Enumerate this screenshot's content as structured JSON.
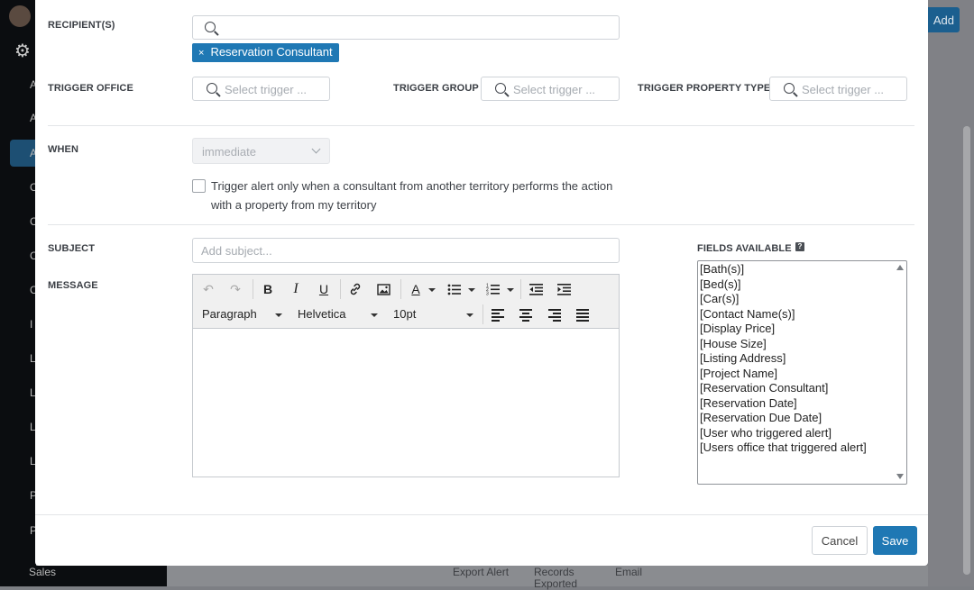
{
  "background": {
    "add_label": "Add",
    "sidebar_letters": [
      "A",
      "A",
      "A",
      "C",
      "C",
      "C",
      "C",
      "I",
      "L",
      "L",
      "L",
      "L",
      "P",
      "P"
    ],
    "sidebar_bottom_label": "Sales",
    "bottom_row": [
      "Export Alert",
      "Records",
      "Email"
    ],
    "bottom_row_second": "Exported"
  },
  "recipients": {
    "label": "RECIPIENT(S)",
    "search_value": "",
    "tags": [
      {
        "label": "Reservation Consultant",
        "remove": "×"
      }
    ]
  },
  "trigger_office": {
    "label": "TRIGGER OFFICE",
    "placeholder": "Select trigger ..."
  },
  "trigger_group": {
    "label": "TRIGGER GROUP",
    "placeholder": "Select trigger ..."
  },
  "trigger_property_type": {
    "label": "TRIGGER PROPERTY TYPE",
    "placeholder": "Select trigger ..."
  },
  "when": {
    "label": "WHEN",
    "selected": "immediate",
    "checkbox_label": "Trigger alert only when a consultant from another territory performs the action with a property from my territory",
    "checked": false
  },
  "subject": {
    "label": "SUBJECT",
    "placeholder": "Add subject..."
  },
  "message": {
    "label": "MESSAGE",
    "format_select": "Paragraph",
    "font_select": "Helvetica",
    "size_select": "10pt",
    "content": ""
  },
  "fields_available": {
    "label": "FIELDS AVAILABLE",
    "items": [
      "[Bath(s)]",
      "[Bed(s)]",
      "[Car(s)]",
      "[Contact Name(s)]",
      "[Display Price]",
      "[House Size]",
      "[Listing Address]",
      "[Project Name]",
      "[Reservation Consultant]",
      "[Reservation Date]",
      "[Reservation Due Date]",
      "[User who triggered alert]",
      "[Users office that triggered alert]"
    ]
  },
  "footer": {
    "cancel_label": "Cancel",
    "save_label": "Save"
  },
  "colors": {
    "accent": "#1f78b4",
    "backdrop": "#7d7f84"
  }
}
